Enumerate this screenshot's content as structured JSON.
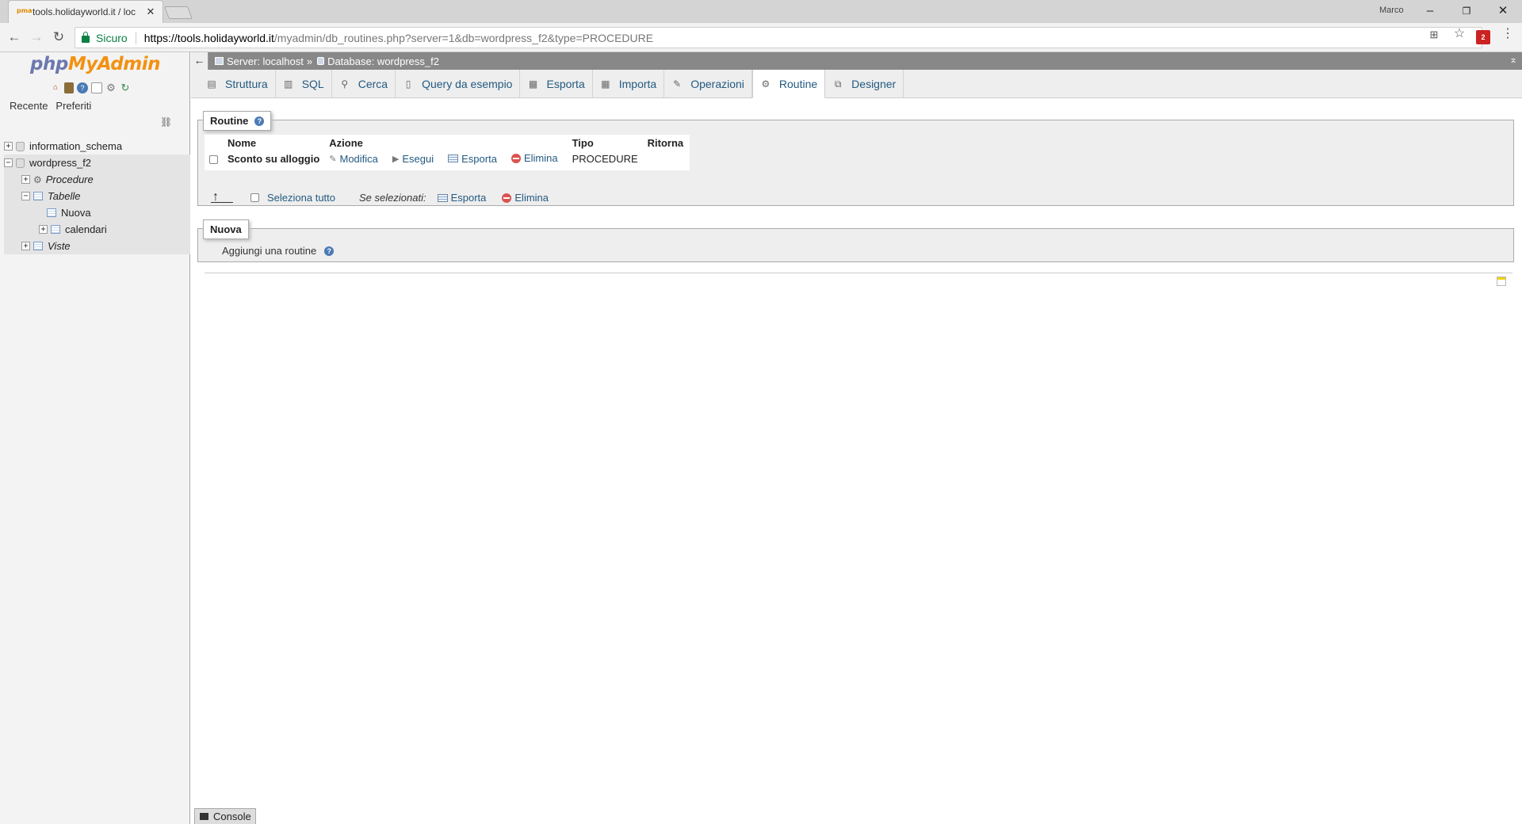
{
  "browser": {
    "tab_title": "tools.holidayworld.it / loc",
    "tab_favicon": "pma",
    "profile_name": "Marco",
    "secure_label": "Sicuro",
    "url_host": "https://tools.holidayworld.it",
    "url_path": "/myadmin/db_routines.php?server=1&db=wordpress_f2&type=PROCEDURE",
    "ext_badge": "2"
  },
  "sidebar": {
    "logo_php": "php",
    "logo_myadmin": "MyAdmin",
    "tabs": [
      "Recente",
      "Preferiti"
    ],
    "tree": {
      "db1": "information_schema",
      "db2": "wordpress_f2",
      "procedures": "Procedure",
      "tables": "Tabelle",
      "new_table": "Nuova",
      "table1": "calendari",
      "views": "Viste"
    }
  },
  "breadcrumb": {
    "server": "Server: localhost",
    "sep": "»",
    "database": "Database: wordpress_f2"
  },
  "menu": {
    "tabs": [
      {
        "label": "Struttura",
        "icon": "structure-icon"
      },
      {
        "label": "SQL",
        "icon": "sql-icon"
      },
      {
        "label": "Cerca",
        "icon": "search-icon"
      },
      {
        "label": "Query da esempio",
        "icon": "query-icon"
      },
      {
        "label": "Esporta",
        "icon": "export-icon"
      },
      {
        "label": "Importa",
        "icon": "import-icon"
      },
      {
        "label": "Operazioni",
        "icon": "wrench-icon"
      },
      {
        "label": "Routine",
        "icon": "routine-icon",
        "active": true
      },
      {
        "label": "Designer",
        "icon": "designer-icon"
      }
    ]
  },
  "routines": {
    "legend": "Routine",
    "headers": {
      "name": "Nome",
      "action": "Azione",
      "type": "Tipo",
      "returns": "Ritorna"
    },
    "rows": [
      {
        "name": "Sconto su alloggio",
        "edit": "Modifica",
        "execute": "Esegui",
        "export": "Esporta",
        "delete": "Elimina",
        "type": "PROCEDURE",
        "returns": ""
      }
    ],
    "select_all": "Seleziona tutto",
    "with_selected": "Se selezionati:",
    "bulk_export": "Esporta",
    "bulk_delete": "Elimina"
  },
  "new_section": {
    "legend": "Nuova",
    "add_routine": "Aggiungi una routine"
  },
  "console": {
    "label": "Console"
  }
}
